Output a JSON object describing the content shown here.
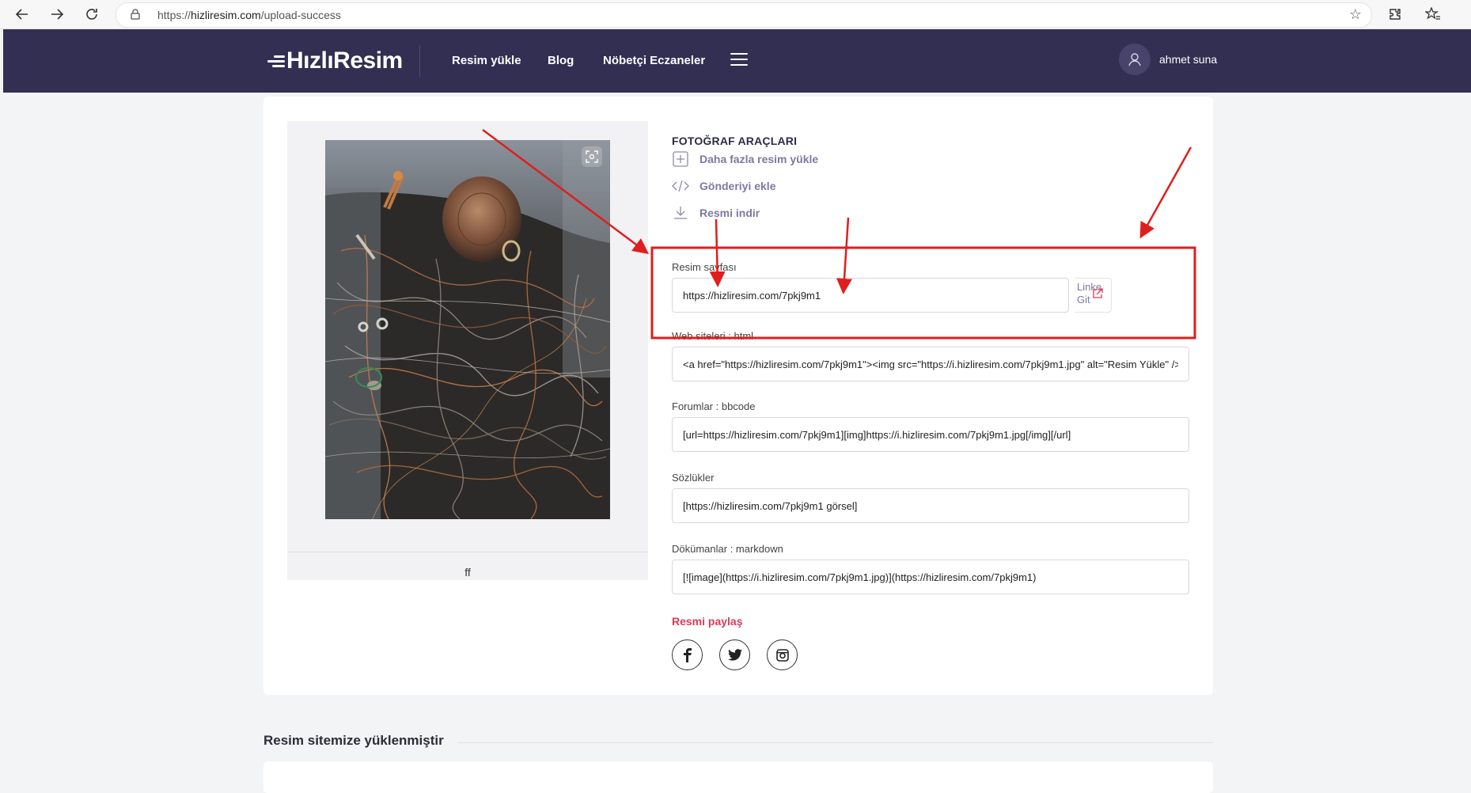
{
  "browser": {
    "url_prefix": "https://",
    "url_host": "hizliresim.com",
    "url_path": "/upload-success"
  },
  "header": {
    "logo_text": "HızlıResim",
    "nav": [
      "Resim yükle",
      "Blog",
      "Nöbetçi Eczaneler"
    ],
    "username": "ahmet suna"
  },
  "tools": {
    "title": "FOTOĞRAF ARAÇLARI",
    "items": [
      {
        "label": "Daha fazla resim yükle",
        "icon": "plus-square-icon"
      },
      {
        "label": "Gönderiyi ekle",
        "icon": "code-icon"
      },
      {
        "label": "Resmi indir",
        "icon": "download-icon"
      }
    ]
  },
  "fields": {
    "resim_sayfasi": {
      "label": "Resim sayfası",
      "value": "https://hizliresim.com/7pkj9m1"
    },
    "html": {
      "label": "Web siteleri : html",
      "value": "<a href=\"https://hizliresim.com/7pkj9m1\"><img src=\"https://i.hizliresim.com/7pkj9m1.jpg\" alt=\"Resim Yükle\" /></a>"
    },
    "bbcode": {
      "label": "Forumlar : bbcode",
      "value": "[url=https://hizliresim.com/7pkj9m1][img]https://i.hizliresim.com/7pkj9m1.jpg[/img][/url]"
    },
    "sozlukler": {
      "label": "Sözlükler",
      "value": "[https://hizliresim.com/7pkj9m1 görsel]"
    },
    "markdown": {
      "label": "Dökümanlar : markdown",
      "value": "[![image](https://i.hizliresim.com/7pkj9m1.jpg)](https://hizliresim.com/7pkj9m1)"
    }
  },
  "go_link": {
    "line1": "Linke",
    "line2": "Git"
  },
  "preview": {
    "caption": "ff"
  },
  "share": {
    "title": "Resmi paylaş",
    "networks": [
      "facebook-icon",
      "twitter-icon",
      "instagram-icon"
    ]
  },
  "uploaded": {
    "title": "Resim sitemize yüklenmiştir"
  },
  "colors": {
    "header_bg": "#322f52",
    "accent_red": "#e0395a",
    "annotation_red": "#e01e1e",
    "tool_text": "#7d7aa0"
  }
}
